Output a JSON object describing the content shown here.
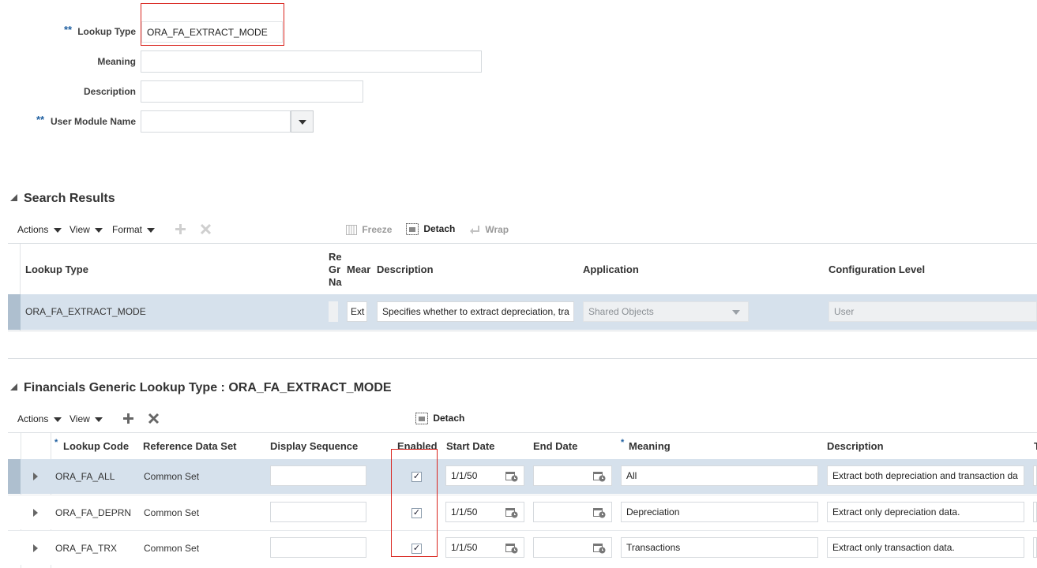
{
  "search_form": {
    "lookup_type_label": "Lookup Type",
    "lookup_type_value": "ORA_FA_EXTRACT_MODE",
    "meaning_label": "Meaning",
    "meaning_value": "",
    "description_label": "Description",
    "description_value": "",
    "user_module_label": "User Module Name",
    "user_module_value": "",
    "required_mark": "**"
  },
  "search_results": {
    "title": "Search Results",
    "toolbar": {
      "actions": "Actions",
      "view": "View",
      "format": "Format",
      "freeze": "Freeze",
      "detach": "Detach",
      "wrap": "Wrap"
    },
    "headers": {
      "lookup_type": "Lookup Type",
      "ref_group_line1": "Re",
      "ref_group_line2": "Gr",
      "ref_group_line3": "Na",
      "meaning": "Mear",
      "description": "Description",
      "application": "Application",
      "configuration_level": "Configuration Level"
    },
    "row": {
      "lookup_type": "ORA_FA_EXTRACT_MODE",
      "meaning": "Ext",
      "description": "Specifies whether to extract depreciation, tra",
      "application": "Shared Objects",
      "configuration_level": "User"
    }
  },
  "detail": {
    "title": "Financials Generic Lookup Type : ORA_FA_EXTRACT_MODE",
    "toolbar": {
      "actions": "Actions",
      "view": "View",
      "detach": "Detach"
    },
    "headers": {
      "lookup_code": "Lookup Code",
      "reference_data_set": "Reference Data Set",
      "display_sequence": "Display Sequence",
      "enabled": "Enabled",
      "start_date": "Start Date",
      "end_date": "End Date",
      "meaning": "Meaning",
      "description": "Description",
      "required_mark": "*",
      "cut_off": "T"
    },
    "rows": [
      {
        "lookup_code": "ORA_FA_ALL",
        "reference_data_set": "Common Set",
        "display_sequence": "",
        "enabled": "✓",
        "start_date": "1/1/50",
        "end_date": "",
        "meaning": "All",
        "description": "Extract both depreciation and transaction da"
      },
      {
        "lookup_code": "ORA_FA_DEPRN",
        "reference_data_set": "Common Set",
        "display_sequence": "",
        "enabled": "✓",
        "start_date": "1/1/50",
        "end_date": "",
        "meaning": "Depreciation",
        "description": "Extract only depreciation data."
      },
      {
        "lookup_code": "ORA_FA_TRX",
        "reference_data_set": "Common Set",
        "display_sequence": "",
        "enabled": "✓",
        "start_date": "1/1/50",
        "end_date": "",
        "meaning": "Transactions",
        "description": "Extract only transaction data."
      }
    ]
  },
  "colors": {
    "selected_row": "#d6e1ec",
    "highlight_border": "#d9241e",
    "required_marker": "#1f5fa0"
  }
}
